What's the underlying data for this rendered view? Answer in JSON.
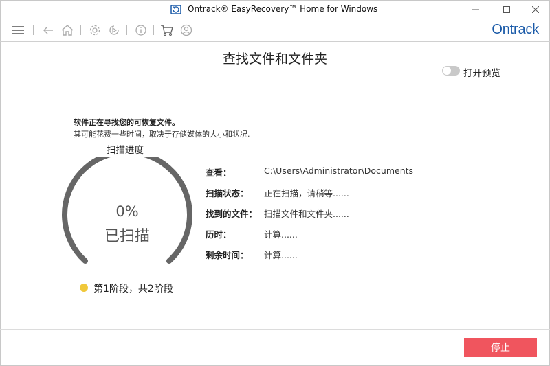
{
  "window": {
    "title": "Ontrack® EasyRecovery™ Home for Windows",
    "minimize_icon": "minimize-icon",
    "maximize_icon": "maximize-icon",
    "close_icon": "close-icon"
  },
  "toolbar": {
    "icons": [
      "menu-icon",
      "back-icon",
      "home-icon",
      "settings-icon",
      "resume-icon",
      "info-icon",
      "cart-icon",
      "account-icon"
    ],
    "brand": "Ontrack",
    "brand_color": "#1a5aa8"
  },
  "main": {
    "title": "查找文件和文件夹",
    "preview_label": "打开预览",
    "preview_on": false,
    "message_bold": "软件正在寻找您的可恢复文件。",
    "message_sub": "其可能花费一些时间，取决于存储媒体的大小和状况.",
    "progress_label": "扫描进度",
    "progress_percent_text": "0%",
    "progress_value": 0,
    "progress_sub": "已扫描",
    "stage_text": "第1阶段，共2阶段",
    "stage_color": "#f0c83a"
  },
  "info": {
    "look_label": "查看：",
    "look_value": "C:\\Users\\Administrator\\Documents",
    "status_label": "扫描状态：",
    "status_value": "正在扫描，请稍等......",
    "found_label": "找到的文件：",
    "found_value": "扫描文件和文件夹......",
    "elapsed_label": "历时：",
    "elapsed_value": "计算......",
    "remaining_label": "剩余时间：",
    "remaining_value": "计算......"
  },
  "footer": {
    "stop_label": "停止",
    "stop_color": "#f0555e"
  }
}
